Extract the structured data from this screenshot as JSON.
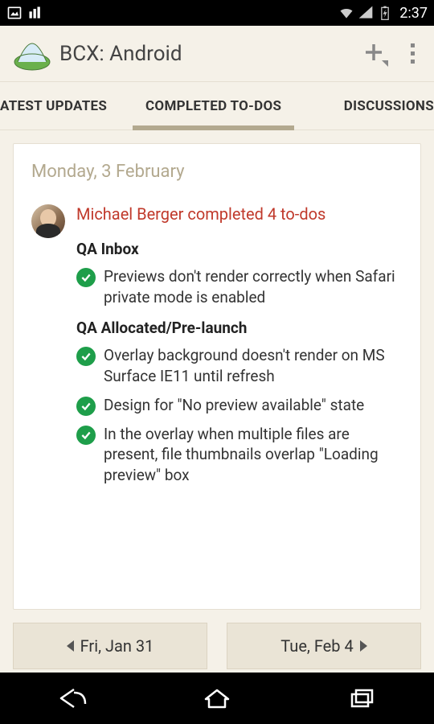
{
  "status": {
    "time": "2:37"
  },
  "app": {
    "title": "BCX: Android"
  },
  "tabs": [
    {
      "label": "ATEST UPDATES",
      "active": false
    },
    {
      "label": "COMPLETED TO-DOS",
      "active": true
    },
    {
      "label": "DISCUSSIONS",
      "active": false
    }
  ],
  "card": {
    "date": "Monday, 3 February",
    "summary": "Michael Berger completed 4 to-dos",
    "groups": [
      {
        "title": "QA Inbox",
        "items": [
          "Previews don't render correctly when Safari private mode is enabled"
        ]
      },
      {
        "title": "QA Allocated/Pre-launch",
        "items": [
          "Overlay background doesn't render on MS Surface IE11 until refresh",
          "Design for \"No preview available\" state",
          "In the overlay when multiple files are present, file thumbnails overlap \"Loading preview\" box"
        ]
      }
    ]
  },
  "nav": {
    "prev": "Fri, Jan 31",
    "next": "Tue, Feb 4"
  }
}
